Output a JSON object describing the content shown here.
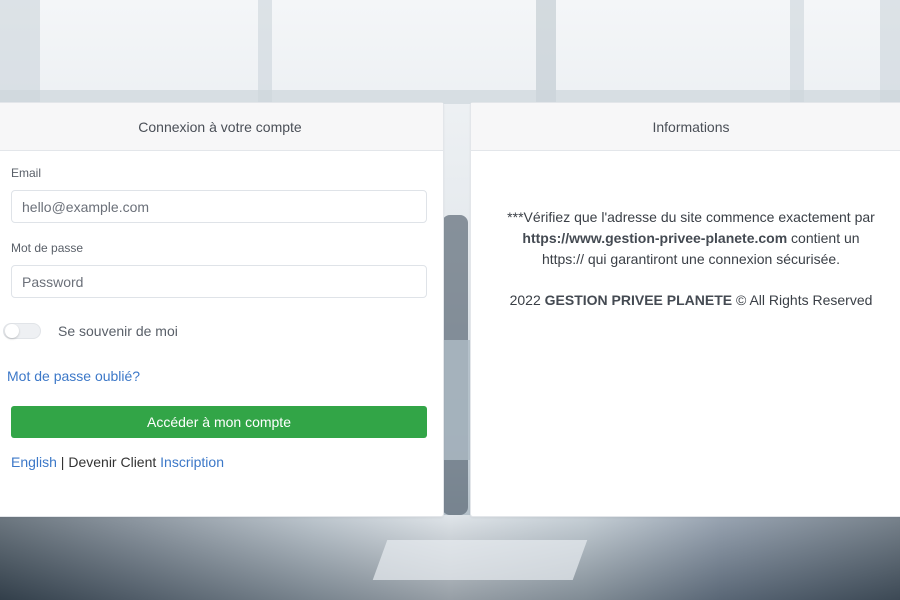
{
  "login": {
    "header": "Connexion à votre compte",
    "email_label": "Email",
    "email_placeholder": "hello@example.com",
    "email_value": "",
    "password_label": "Mot de passe",
    "password_placeholder": "Password",
    "password_value": "",
    "remember_label": "Se souvenir de moi",
    "remember_checked": false,
    "forgot_link": "Mot de passe oublié?",
    "submit_button": "Accéder à mon compte",
    "language_link": "English",
    "separator": " | ",
    "become_client_text": "Devenir Client ",
    "signup_link": "Inscription"
  },
  "info": {
    "header": "Informations",
    "notice_prefix": "***Vérifiez que l'adresse du site commence exactement par ",
    "notice_url": "https://www.gestion-privee-planete.com",
    "notice_suffix": " contient un https:// qui garantiront une connexion sécurisée.",
    "copyright_year": "2022 ",
    "copyright_company": "GESTION PRIVEE PLANETE",
    "copyright_suffix": " © All Rights Reserved"
  },
  "colors": {
    "accent_green": "#32a547",
    "link_blue": "#3c78c8"
  }
}
